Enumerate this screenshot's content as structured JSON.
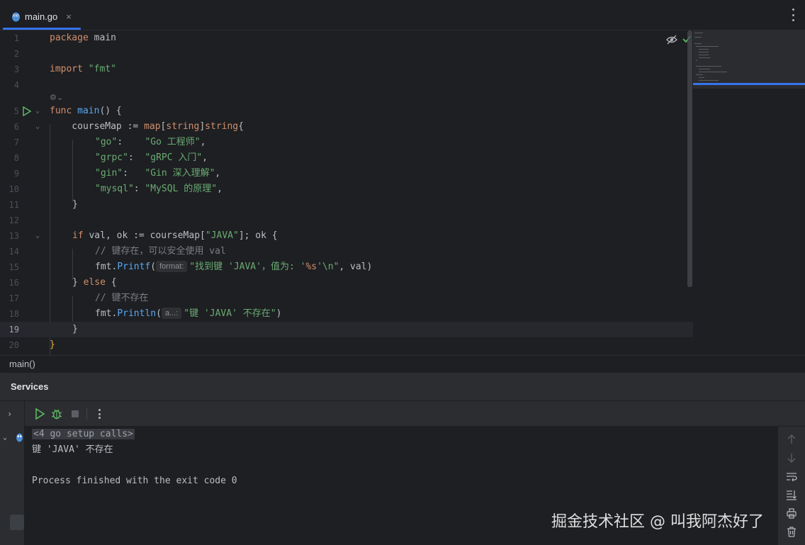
{
  "tab": {
    "label": "main.go",
    "close": "×"
  },
  "editor": {
    "lines": [
      {
        "n": "1"
      },
      {
        "n": "2"
      },
      {
        "n": "3"
      },
      {
        "n": "4"
      },
      {
        "n": "5"
      },
      {
        "n": "6"
      },
      {
        "n": "7"
      },
      {
        "n": "8"
      },
      {
        "n": "9"
      },
      {
        "n": "10"
      },
      {
        "n": "11"
      },
      {
        "n": "12"
      },
      {
        "n": "13"
      },
      {
        "n": "14"
      },
      {
        "n": "15"
      },
      {
        "n": "16"
      },
      {
        "n": "17"
      },
      {
        "n": "18"
      },
      {
        "n": "19"
      },
      {
        "n": "20"
      }
    ],
    "current_line": "19",
    "code": {
      "l1a": "package",
      "l1b": " main",
      "l3a": "import",
      "l3b": " \"fmt\"",
      "l5a": "func",
      "l5b": " main",
      "l5c": "() {",
      "l6a": "    courseMap := ",
      "l6b": "map",
      "l6c": "[",
      "l6d": "string",
      "l6e": "]",
      "l6f": "string",
      "l6g": "{",
      "l7a": "\"go\"",
      "l7b": ":    ",
      "l7c": "\"Go 工程师\"",
      "l7d": ",",
      "l8a": "\"grpc\"",
      "l8b": ":  ",
      "l8c": "\"gRPC 入门\"",
      "l8d": ",",
      "l9a": "\"gin\"",
      "l9b": ":   ",
      "l9c": "\"Gin 深入理解\"",
      "l9d": ",",
      "l10a": "\"mysql\"",
      "l10b": ": ",
      "l10c": "\"MySQL 的原理\"",
      "l10d": ",",
      "l11": "}",
      "l13a": "if",
      "l13b": " val, ok := courseMap[",
      "l13c": "\"JAVA\"",
      "l13d": "]; ok {",
      "l14": "// 键存在，可以安全使用 val",
      "l15a": "fmt.",
      "l15b": "Printf",
      "l15c": "(",
      "l15hint": "format:",
      "l15d": "\"找到键 'JAVA'，值为: '",
      "l15e": "%s",
      "l15f": "'\\n\"",
      "l15g": ", val)",
      "l16a": "} ",
      "l16b": "else",
      "l16c": " {",
      "l17": "// 键不存在",
      "l18a": "fmt.",
      "l18b": "Println",
      "l18c": "(",
      "l18hint": "a...:",
      "l18d": "\"键 'JAVA' 不存在\"",
      "l18e": ")",
      "l19": "}",
      "l20": "}"
    }
  },
  "breadcrumb": "main()",
  "services": {
    "title": "Services",
    "console": {
      "setup": "<4 go setup calls>",
      "out1": "键 'JAVA' 不存在",
      "out2": "Process finished with the exit code 0"
    }
  },
  "watermark": "掘金技术社区 @ 叫我阿杰好了",
  "colors": {
    "accent": "#3574f0",
    "keyword": "#cf8e6d",
    "string": "#6aab73",
    "function": "#56a8f5",
    "run": "#5fb865"
  }
}
